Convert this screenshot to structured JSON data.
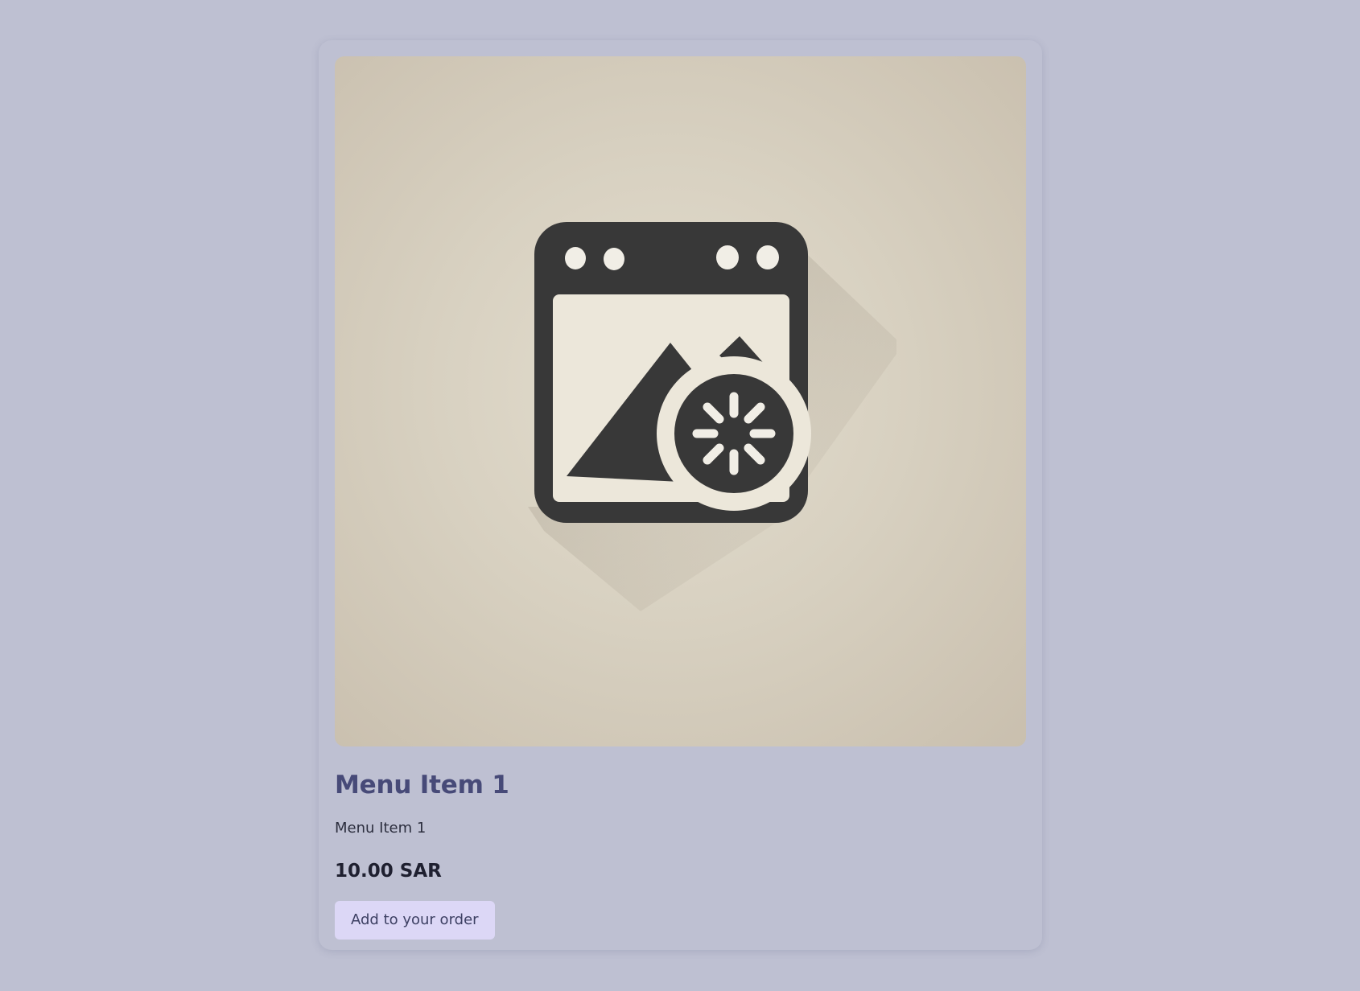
{
  "product": {
    "image_icon": "image-loading-placeholder-icon",
    "title": "Menu Item 1",
    "description": "Menu Item 1",
    "price": "10.00 SAR",
    "add_button_label": "Add to your order"
  },
  "colors": {
    "page_background": "#bec0d2",
    "title": "#474a78",
    "button_background": "#dcd7f6",
    "icon_dark": "#383838",
    "icon_light": "#ece7da"
  }
}
